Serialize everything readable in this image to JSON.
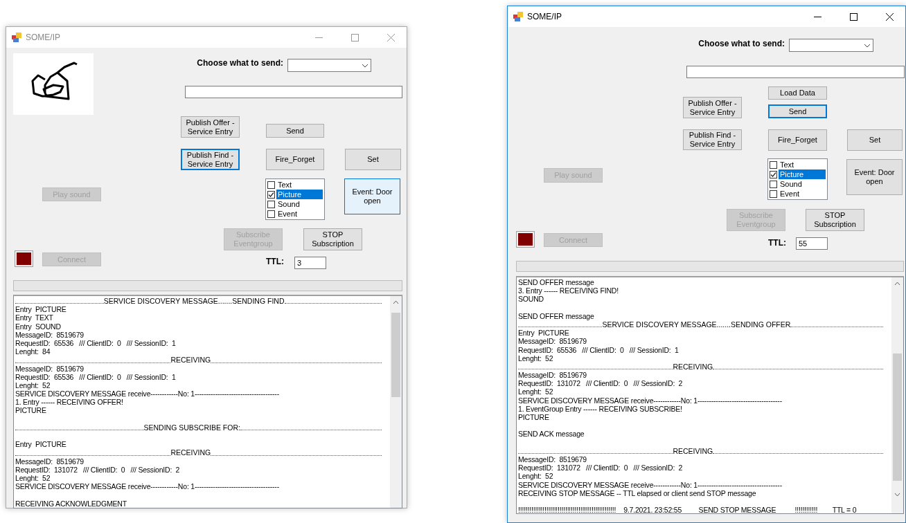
{
  "windows": [
    {
      "title": "SOME/IP",
      "active": false,
      "has_sketch": true,
      "choose_label": "Choose what to send:",
      "ttl_label": "TTL:",
      "ttl_value": "3",
      "indicator": {
        "color": "#800000"
      },
      "buttons": [
        {
          "label": "Publish Offer - Service Entry",
          "disabled": false,
          "focused": false,
          "hovered": false
        },
        {
          "label": "Send",
          "disabled": false,
          "focused": false,
          "hovered": false
        },
        {
          "label": "Publish Find - Service Entry",
          "disabled": false,
          "focused": true,
          "hovered": false
        },
        {
          "label": "Fire_Forget",
          "disabled": false,
          "focused": false,
          "hovered": false
        },
        {
          "label": "Set",
          "disabled": false,
          "focused": false,
          "hovered": false
        },
        {
          "label": "Play sound",
          "disabled": true,
          "focused": false,
          "hovered": false
        },
        {
          "label": "Event: Door open",
          "disabled": false,
          "focused": false,
          "hovered": true
        },
        {
          "label": "Subscribe Eventgroup",
          "disabled": true,
          "focused": false,
          "hovered": false
        },
        {
          "label": "STOP Subscription",
          "disabled": false,
          "focused": false,
          "hovered": false
        },
        {
          "label": "Connect",
          "disabled": true,
          "focused": false,
          "hovered": false
        }
      ],
      "checklist": [
        {
          "label": "Text",
          "checked": false,
          "selected": false
        },
        {
          "label": "Picture",
          "checked": true,
          "selected": true
        },
        {
          "label": "Sound",
          "checked": false,
          "selected": false
        },
        {
          "label": "Event",
          "checked": false,
          "selected": false
        }
      ],
      "log": [
        {
          "kind": "rule",
          "text": "SERVICE DISCOVERY MESSAGE.......SENDING FIND"
        },
        {
          "kind": "text",
          "text": "Entry  PICTURE"
        },
        {
          "kind": "text",
          "text": "Entry  TEXT"
        },
        {
          "kind": "text",
          "text": "Entry  SOUND"
        },
        {
          "kind": "text",
          "text": "MessageID:  8519679"
        },
        {
          "kind": "text",
          "text": "RequestID:  65536   /// ClientID:  0   /// SessionID:  1"
        },
        {
          "kind": "text",
          "text": "Lenght:  84"
        },
        {
          "kind": "rule",
          "text": "RECEIVING"
        },
        {
          "kind": "text",
          "text": "MessageID:  8519679"
        },
        {
          "kind": "text",
          "text": "RequestID:  65536   /// ClientID:  0   /// SessionID:  1"
        },
        {
          "kind": "text",
          "text": "Lenght:  52"
        },
        {
          "kind": "text",
          "text": "SERVICE DISCOVERY MESSAGE receive------------No: 1-------------------------------------"
        },
        {
          "kind": "text",
          "text": "1. Entry ------ RECEIVING OFFER!"
        },
        {
          "kind": "text",
          "text": "PICTURE"
        },
        {
          "kind": "gap"
        },
        {
          "kind": "rule",
          "text": "SENDING SUBSCRIBE FOR:"
        },
        {
          "kind": "gap"
        },
        {
          "kind": "text",
          "text": "Entry  PICTURE"
        },
        {
          "kind": "rule",
          "text": "RECEIVING"
        },
        {
          "kind": "text",
          "text": "MessageID:  8519679"
        },
        {
          "kind": "text",
          "text": "RequestID:  131072   /// ClientID:  0   /// SessionID:  2"
        },
        {
          "kind": "text",
          "text": "Lenght:  52"
        },
        {
          "kind": "text",
          "text": "SERVICE DISCOVERY MESSAGE receive------------No: 1-------------------------------------"
        },
        {
          "kind": "gap"
        },
        {
          "kind": "text",
          "text": "RECEIVING ACKNOWLEDGMENT"
        }
      ]
    },
    {
      "title": "SOME/IP",
      "active": true,
      "has_sketch": false,
      "choose_label": "Choose what to send:",
      "ttl_label": "TTL:",
      "ttl_value": "55",
      "indicator": {
        "color": "#800000"
      },
      "buttons": [
        {
          "label": "Load Data",
          "disabled": false,
          "focused": false,
          "hovered": false
        },
        {
          "label": "Publish Offer - Service Entry",
          "disabled": false,
          "focused": false,
          "hovered": false
        },
        {
          "label": "Send",
          "disabled": false,
          "focused": true,
          "hovered": false
        },
        {
          "label": "Publish Find - Service Entry",
          "disabled": false,
          "focused": false,
          "hovered": false
        },
        {
          "label": "Fire_Forget",
          "disabled": false,
          "focused": false,
          "hovered": false
        },
        {
          "label": "Set",
          "disabled": false,
          "focused": false,
          "hovered": false
        },
        {
          "label": "Play sound",
          "disabled": true,
          "focused": false,
          "hovered": false
        },
        {
          "label": "Event: Door open",
          "disabled": false,
          "focused": false,
          "hovered": false
        },
        {
          "label": "Subscribe Eventgroup",
          "disabled": true,
          "focused": false,
          "hovered": false
        },
        {
          "label": "STOP Subscription",
          "disabled": false,
          "focused": false,
          "hovered": false
        },
        {
          "label": "Connect",
          "disabled": true,
          "focused": false,
          "hovered": false
        }
      ],
      "checklist": [
        {
          "label": "Text",
          "checked": false,
          "selected": false
        },
        {
          "label": "Picture",
          "checked": true,
          "selected": true
        },
        {
          "label": "Sound",
          "checked": false,
          "selected": false
        },
        {
          "label": "Event",
          "checked": false,
          "selected": false
        }
      ],
      "log": [
        {
          "kind": "text",
          "text": "SEND OFFER message"
        },
        {
          "kind": "text",
          "text": "3. Entry ------ RECEIVING FIND!"
        },
        {
          "kind": "text",
          "text": "SOUND"
        },
        {
          "kind": "gap"
        },
        {
          "kind": "text",
          "text": "SEND OFFER message"
        },
        {
          "kind": "rule",
          "text": "SERVICE DISCOVERY MESSAGE.......SENDING OFFER"
        },
        {
          "kind": "text",
          "text": "Entry  PICTURE"
        },
        {
          "kind": "text",
          "text": "MessageID:  8519679"
        },
        {
          "kind": "text",
          "text": "RequestID:  65536   /// ClientID:  0   /// SessionID:  1"
        },
        {
          "kind": "text",
          "text": "Lenght:  52"
        },
        {
          "kind": "rule",
          "text": "RECEIVING"
        },
        {
          "kind": "text",
          "text": "MessageID:  8519679"
        },
        {
          "kind": "text",
          "text": "RequestID:  131072   /// ClientID:  0   /// SessionID:  2"
        },
        {
          "kind": "text",
          "text": "Lenght:  52"
        },
        {
          "kind": "text",
          "text": "SERVICE DISCOVERY MESSAGE receive------------No: 1-------------------------------------"
        },
        {
          "kind": "text",
          "text": "1. EventGroup Entry ------ RECEIVING SUBSCRIBE!"
        },
        {
          "kind": "text",
          "text": "PICTURE"
        },
        {
          "kind": "gap"
        },
        {
          "kind": "text",
          "text": "SEND ACK message"
        },
        {
          "kind": "gap"
        },
        {
          "kind": "rule",
          "text": "RECEIVING"
        },
        {
          "kind": "text",
          "text": "MessageID:  8519679"
        },
        {
          "kind": "text",
          "text": "RequestID:  131072   /// ClientID:  0   /// SessionID:  2"
        },
        {
          "kind": "text",
          "text": "Lenght:  52"
        },
        {
          "kind": "text",
          "text": "SERVICE DISCOVERY MESSAGE receive------------No: 1-------------------------------------"
        },
        {
          "kind": "text",
          "text": "RECEIVING STOP MESSAGE -- TTL elapsed or client send STOP message"
        },
        {
          "kind": "gap"
        },
        {
          "kind": "text",
          "text": "!!!!!!!!!!!!!!!!!!!!!!!!!!!!!!!!!!!!!!!!!!!!!!!!!!!!    9.7.2021. 23:52:55         SEND STOP MESSAGE          !!!!!!!!!!!!        TTL = 0"
        }
      ]
    }
  ]
}
